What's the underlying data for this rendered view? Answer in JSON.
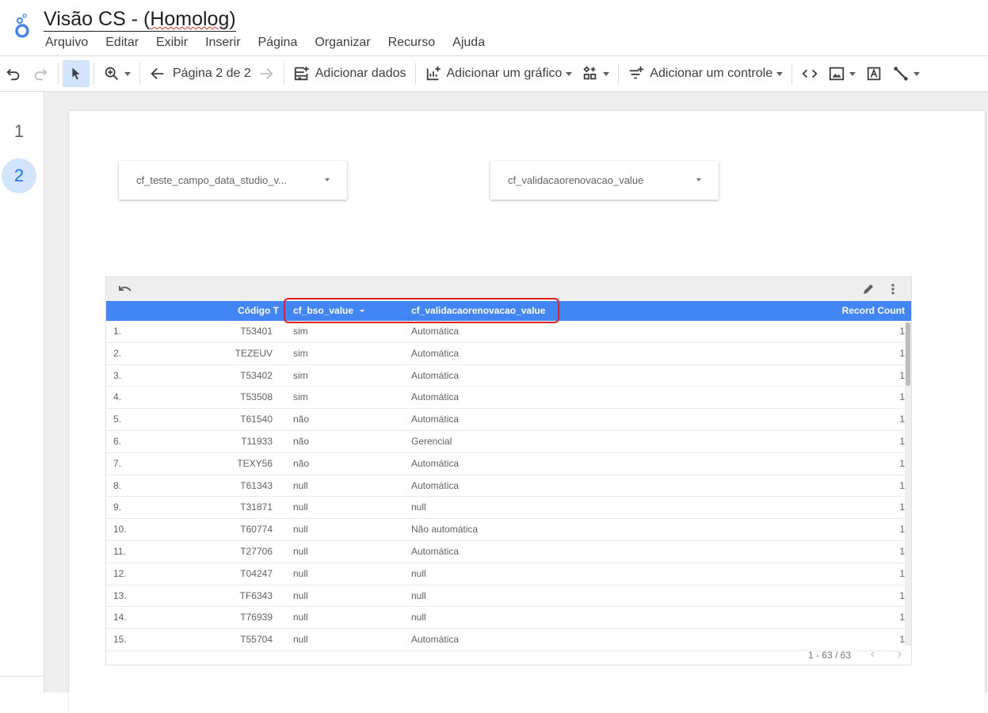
{
  "app": {
    "title_plain": "Visão CS - (",
    "title_squiggle": "Homolog",
    "title_end": ")"
  },
  "menu": [
    "Arquivo",
    "Editar",
    "Exibir",
    "Inserir",
    "Página",
    "Organizar",
    "Recurso",
    "Ajuda"
  ],
  "toolbar": {
    "page_indicator": "Página 2 de 2",
    "add_data": "Adicionar dados",
    "add_chart": "Adicionar um gráfico",
    "add_control": "Adicionar um controle"
  },
  "pages": [
    "1",
    "2"
  ],
  "controls": {
    "filter1": "cf_teste_campo_data_studio_v...",
    "filter2": "cf_validacaorenovacao_value"
  },
  "table": {
    "headers": [
      "Código T",
      "cf_bso_value",
      "cf_validacaorenovacao_value",
      "Record Count"
    ],
    "rows": [
      [
        "1.",
        "T53401",
        "sim",
        "Automática",
        "1"
      ],
      [
        "2.",
        "TEZEUV",
        "sim",
        "Automática",
        "1"
      ],
      [
        "3.",
        "T53402",
        "sim",
        "Automática",
        "1"
      ],
      [
        "4.",
        "T53508",
        "sim",
        "Automática",
        "1"
      ],
      [
        "5.",
        "T61540",
        "não",
        "Automática",
        "1"
      ],
      [
        "6.",
        "T11933",
        "não",
        "Gerencial",
        "1"
      ],
      [
        "7.",
        "TEXY56",
        "não",
        "Automática",
        "1"
      ],
      [
        "8.",
        "T61343",
        "null",
        "Automática",
        "1"
      ],
      [
        "9.",
        "T31871",
        "null",
        "null",
        "1"
      ],
      [
        "10.",
        "T60774",
        "null",
        "Não automática",
        "1"
      ],
      [
        "11.",
        "T27706",
        "null",
        "Automática",
        "1"
      ],
      [
        "12.",
        "T04247",
        "null",
        "null",
        "1"
      ],
      [
        "13.",
        "TF6343",
        "null",
        "null",
        "1"
      ],
      [
        "14.",
        "T76939",
        "null",
        "null",
        "1"
      ],
      [
        "15.",
        "T55704",
        "null",
        "Automática",
        "1"
      ]
    ],
    "pagination": "1 - 63 / 63"
  },
  "colors": {
    "header": "#4285f4",
    "highlight": "#e02020",
    "accent": "#1a73e8"
  }
}
